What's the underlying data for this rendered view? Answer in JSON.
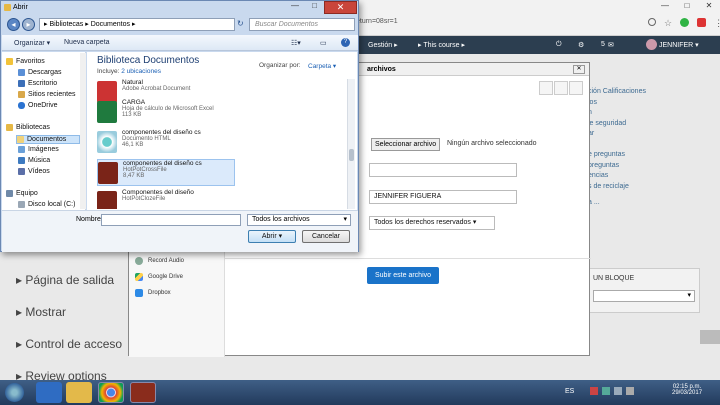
{
  "browser": {
    "url_fragment": "eturn=08sr=1",
    "min": "—",
    "max": "□",
    "close": "✕"
  },
  "navbar": {
    "gestion": "Gestión ▸",
    "this_course": "▸ This course ▸",
    "jennifer": "JENNIFER ▾",
    "msg_count": "5"
  },
  "side_links": [
    "ción Calificaciones",
    "los",
    "n",
    "le seguridad",
    "ar",
    "e preguntas",
    "preguntas",
    "encias",
    "s de reciclaje",
    "a ..."
  ],
  "side_block_title": "UN BLOQUE",
  "left_nav": [
    "Página de salida",
    "Mostrar",
    "Control de acceso",
    "Review options"
  ],
  "modal": {
    "title": "archivos",
    "repos": [
      "Record Audio",
      "Google Drive",
      "Dropbox"
    ],
    "select_button": "Seleccionar archivo",
    "no_file": "Ningún archivo seleccionado",
    "author": "JENNIFER FIGUERA",
    "license": "Todos los derechos reservados",
    "submit": "Subir este archivo"
  },
  "dialog": {
    "title": "Abrir",
    "address": "▸ Bibliotecas ▸ Documentos ▸",
    "search_placeholder": "Buscar Documentos",
    "organize": "Organizar ▾",
    "new_folder": "Nueva carpeta",
    "library_title": "Biblioteca Documentos",
    "includes": "Incluye:",
    "locations": "2 ubicaciones",
    "arrange_by": "Organizar por:",
    "arrange_value": "Carpeta ▾",
    "nav": {
      "favorites": "Favoritos",
      "fav_items": [
        "Descargas",
        "Escritorio",
        "Sitios recientes",
        "OneDrive"
      ],
      "libraries": "Bibliotecas",
      "lib_items": [
        "Documentos",
        "Imágenes",
        "Música",
        "Vídeos"
      ],
      "computer": "Equipo",
      "disk": "Disco local (C:)"
    },
    "files": [
      {
        "name": "Natural",
        "type": "Adobe Acrobat Document",
        "size": ""
      },
      {
        "name": "CARGA",
        "type": "Hoja de cálculo de Microsoft Excel",
        "size": "113 KB"
      },
      {
        "name": "componentes del diseño cs",
        "type": "Documento HTML",
        "size": "46,1 KB"
      },
      {
        "name": "componentes del diseño cs",
        "type": "HotPotCrossFile",
        "size": "8,47 KB"
      },
      {
        "name": "Componentes del diseño",
        "type": "HotPotClozeFile",
        "size": ""
      }
    ],
    "filename_label": "Nombre:",
    "filetype": "Todos los archivos",
    "open": "Abrir",
    "cancel": "Cancelar"
  },
  "taskbar": {
    "lang": "ES",
    "time": "02:15 p.m.",
    "date": "29/03/2017"
  }
}
